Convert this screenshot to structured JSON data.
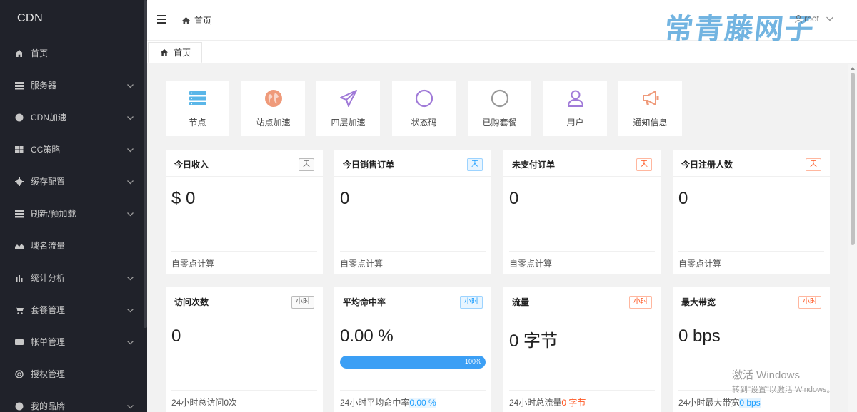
{
  "sidebar": {
    "logo": "CDN",
    "items": [
      {
        "label": "首页",
        "icon": "home-icon",
        "has_children": false
      },
      {
        "label": "服务器",
        "icon": "server-icon",
        "has_children": true
      },
      {
        "label": "CDN加速",
        "icon": "globe-icon",
        "has_children": true
      },
      {
        "label": "CC策略",
        "icon": "grid-icon",
        "has_children": true
      },
      {
        "label": "缓存配置",
        "icon": "gear-icon",
        "has_children": true
      },
      {
        "label": "刷新/预加载",
        "icon": "list-icon",
        "has_children": true
      },
      {
        "label": "域名流量",
        "icon": "area-chart-icon",
        "has_children": false
      },
      {
        "label": "统计分析",
        "icon": "bar-chart-icon",
        "has_children": true
      },
      {
        "label": "套餐管理",
        "icon": "cart-icon",
        "has_children": true
      },
      {
        "label": "帐单管理",
        "icon": "card-icon",
        "has_children": true
      },
      {
        "label": "授权管理",
        "icon": "copyright-icon",
        "has_children": false
      },
      {
        "label": "我的品牌",
        "icon": "brand-icon",
        "has_children": true
      }
    ]
  },
  "header": {
    "breadcrumb": "首页",
    "watermark": "常青藤网子",
    "user": "root"
  },
  "tabs": [
    {
      "label": "首页"
    }
  ],
  "shortcuts": [
    {
      "label": "节点",
      "icon": "server-icon",
      "color": "#5ab6e8"
    },
    {
      "label": "站点加速",
      "icon": "globe-icon",
      "color": "#ef9a7a"
    },
    {
      "label": "四层加速",
      "icon": "paper-plane-icon",
      "color": "#a07ad8"
    },
    {
      "label": "状态码",
      "icon": "circle-icon",
      "color": "#a07ad8"
    },
    {
      "label": "已购套餐",
      "icon": "circle-icon",
      "color": "#999999"
    },
    {
      "label": "用户",
      "icon": "user-icon",
      "color": "#a07ad8"
    },
    {
      "label": "通知信息",
      "icon": "megaphone-icon",
      "color": "#ef9a7a"
    }
  ],
  "cards_row1": [
    {
      "title": "今日收入",
      "badge": "天",
      "badge_style": "gray",
      "value": "$ 0",
      "footer": "自零点计算"
    },
    {
      "title": "今日销售订单",
      "badge": "天",
      "badge_style": "blue",
      "value": "0",
      "footer": "自零点计算"
    },
    {
      "title": "未支付订单",
      "badge": "天",
      "badge_style": "orange",
      "value": "0",
      "footer": "自零点计算"
    },
    {
      "title": "今日注册人数",
      "badge": "天",
      "badge_style": "orange",
      "value": "0",
      "footer": "自零点计算"
    }
  ],
  "cards_row2": [
    {
      "title": "访问次数",
      "badge": "小时",
      "badge_style": "gray",
      "value": "0",
      "footer": "24小时总访问0次",
      "footer_hl": ""
    },
    {
      "title": "平均命中率",
      "badge": "小时",
      "badge_style": "blue",
      "value": "0.00 %",
      "progress": 1.0,
      "progress_label": "100%",
      "footer": "24小时平均命中率",
      "footer_hl": "0.00 %"
    },
    {
      "title": "流量",
      "badge": "小时",
      "badge_style": "orange",
      "value": "0 字节",
      "footer": "24小时总流量",
      "footer_hl": "0 字节"
    },
    {
      "title": "最大带宽",
      "badge": "小时",
      "badge_style": "orange",
      "value": "0 bps",
      "footer": "24小时最大带宽",
      "footer_hl": "0 bps"
    }
  ],
  "windows_activation": {
    "title": "激活 Windows",
    "subtitle": "转到\"设置\"以激活 Windows。"
  }
}
